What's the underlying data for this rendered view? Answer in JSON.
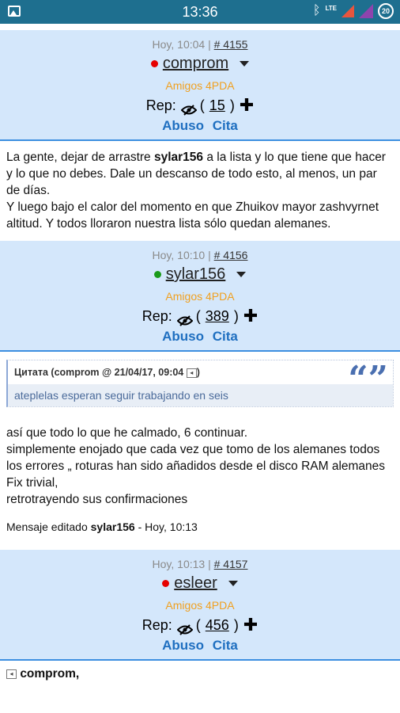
{
  "status": {
    "time": "13:36",
    "network": "LTE",
    "battery": "20"
  },
  "posts": [
    {
      "time": "Hoy, 10:04 |",
      "number": "# 4155",
      "online_color": "#e60000",
      "user": "comprom",
      "group": "Amigos 4PDA",
      "rep_label": "Rep:",
      "rep_count": "15",
      "abuse": "Abuso",
      "cite": "Cita",
      "body": {
        "p1_before": "La gente, dejar de arrastre ",
        "p1_bold": "sylar156",
        "p1_after": " a la lista y lo que tiene que hacer y lo que no debes. Dale un descanso de todo esto, al menos, un par de días.",
        "p2": "Y luego bajo el calor del momento en que Zhuikov mayor zashvyrnet altitud. Y todos lloraron nuestra lista sólo quedan alemanes."
      }
    },
    {
      "time": "Hoy, 10:10 |",
      "number": "# 4156",
      "online_color": "#1a9a1a",
      "user": "sylar156",
      "group": "Amigos 4PDA",
      "rep_label": "Rep:",
      "rep_count": "389",
      "abuse": "Abuso",
      "cite": "Cita",
      "quote": {
        "header": "Цитата (comprom @ 21/04/17, 09:04",
        "text": "ateplelas esperan seguir trabajando en seis"
      },
      "lines": [
        "así que todo lo que he calmado, 6 continuar.",
        "simplemente enojado que cada vez que tomo de los alemanes todos los errores „ roturas han sido añadidos desde el disco RAM alemanes Fix trivial,",
        "retrotrayendo sus confirmaciones"
      ],
      "edited_prefix": "Mensaje editado ",
      "edited_user": "sylar156",
      "edited_suffix": " - Hoy, 10:13"
    },
    {
      "time": "Hoy, 10:13 |",
      "number": "# 4157",
      "online_color": "#e60000",
      "user": "esleer",
      "group": "Amigos 4PDA",
      "rep_label": "Rep:",
      "rep_count": "456",
      "abuse": "Abuso",
      "cite": "Cita",
      "reply_to": "comprom,"
    }
  ]
}
